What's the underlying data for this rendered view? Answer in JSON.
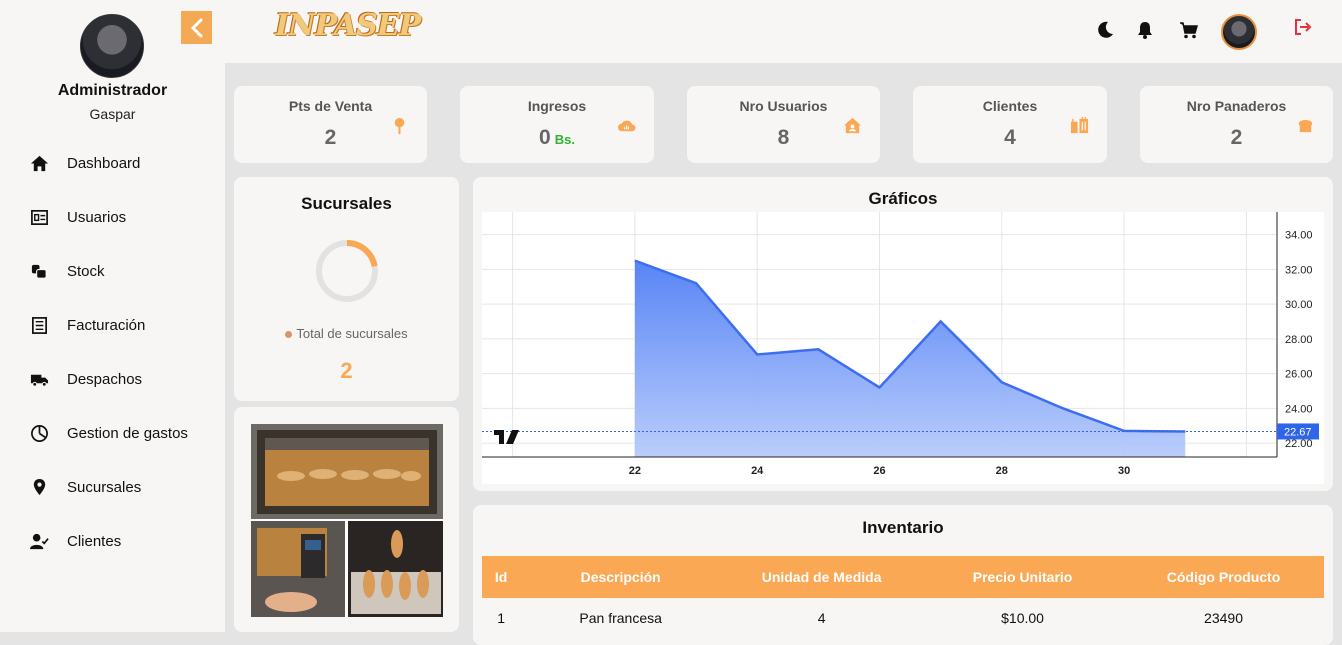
{
  "sidebar": {
    "role": "Administrador",
    "username": "Gaspar",
    "items": [
      {
        "label": "Dashboard"
      },
      {
        "label": "Usuarios"
      },
      {
        "label": "Stock"
      },
      {
        "label": "Facturación"
      },
      {
        "label": "Despachos"
      },
      {
        "label": "Gestion de gastos"
      },
      {
        "label": "Sucursales"
      },
      {
        "label": "Clientes"
      }
    ]
  },
  "header": {
    "logo": "INPASEP",
    "icons": [
      "moon-icon",
      "bell-icon",
      "cart-icon",
      "user-avatar",
      "logout-icon"
    ]
  },
  "stats": [
    {
      "title": "Pts de Venta",
      "value": "2",
      "unit": "",
      "icon": "location-pin-icon"
    },
    {
      "title": "Ingresos",
      "value": "0",
      "unit": "Bs.",
      "icon": "cloud-icon"
    },
    {
      "title": "Nro Usuarios",
      "value": "8",
      "unit": "",
      "icon": "house-icon"
    },
    {
      "title": "Clientes",
      "value": "4",
      "unit": "",
      "icon": "luggage-icon"
    },
    {
      "title": "Nro Panaderos",
      "value": "2",
      "unit": "",
      "icon": "bread-icon"
    }
  ],
  "sucursales": {
    "title": "Sucursales",
    "legend": "Total de sucursales",
    "total": "2"
  },
  "graficos": {
    "title": "Gráficos",
    "last_value_label": "22.67"
  },
  "chart_data": {
    "type": "area",
    "x": [
      22,
      23,
      24,
      25,
      26,
      27,
      28,
      29,
      30,
      31
    ],
    "values": [
      32.5,
      31.2,
      27.1,
      27.4,
      25.2,
      29.0,
      25.5,
      24.0,
      22.7,
      22.67
    ],
    "xticks": [
      "22",
      "24",
      "26",
      "28",
      "30"
    ],
    "yticks": [
      "34.00",
      "32.00",
      "30.00",
      "28.00",
      "26.00",
      "24.00",
      "22.00"
    ],
    "ylim": [
      21.2,
      35.3
    ],
    "xlim": [
      19.5,
      32.5
    ],
    "grid": true,
    "colors": {
      "line": "#3d6ef0",
      "fill_top": "#4f7ef5",
      "fill_bottom": "#b7cbfb",
      "badge": "#2f65e8"
    }
  },
  "inventario": {
    "title": "Inventario",
    "columns": [
      "Id",
      "Descripción",
      "Unidad de Medida",
      "Precio Unitario",
      "Código Producto"
    ],
    "rows": [
      [
        "1",
        "Pan francesa",
        "4",
        "$10.00",
        "23490"
      ]
    ]
  },
  "colors": {
    "accent": "#fba855",
    "page_bg": "#e4e4e4",
    "card_bg": "#f7f6f5"
  }
}
